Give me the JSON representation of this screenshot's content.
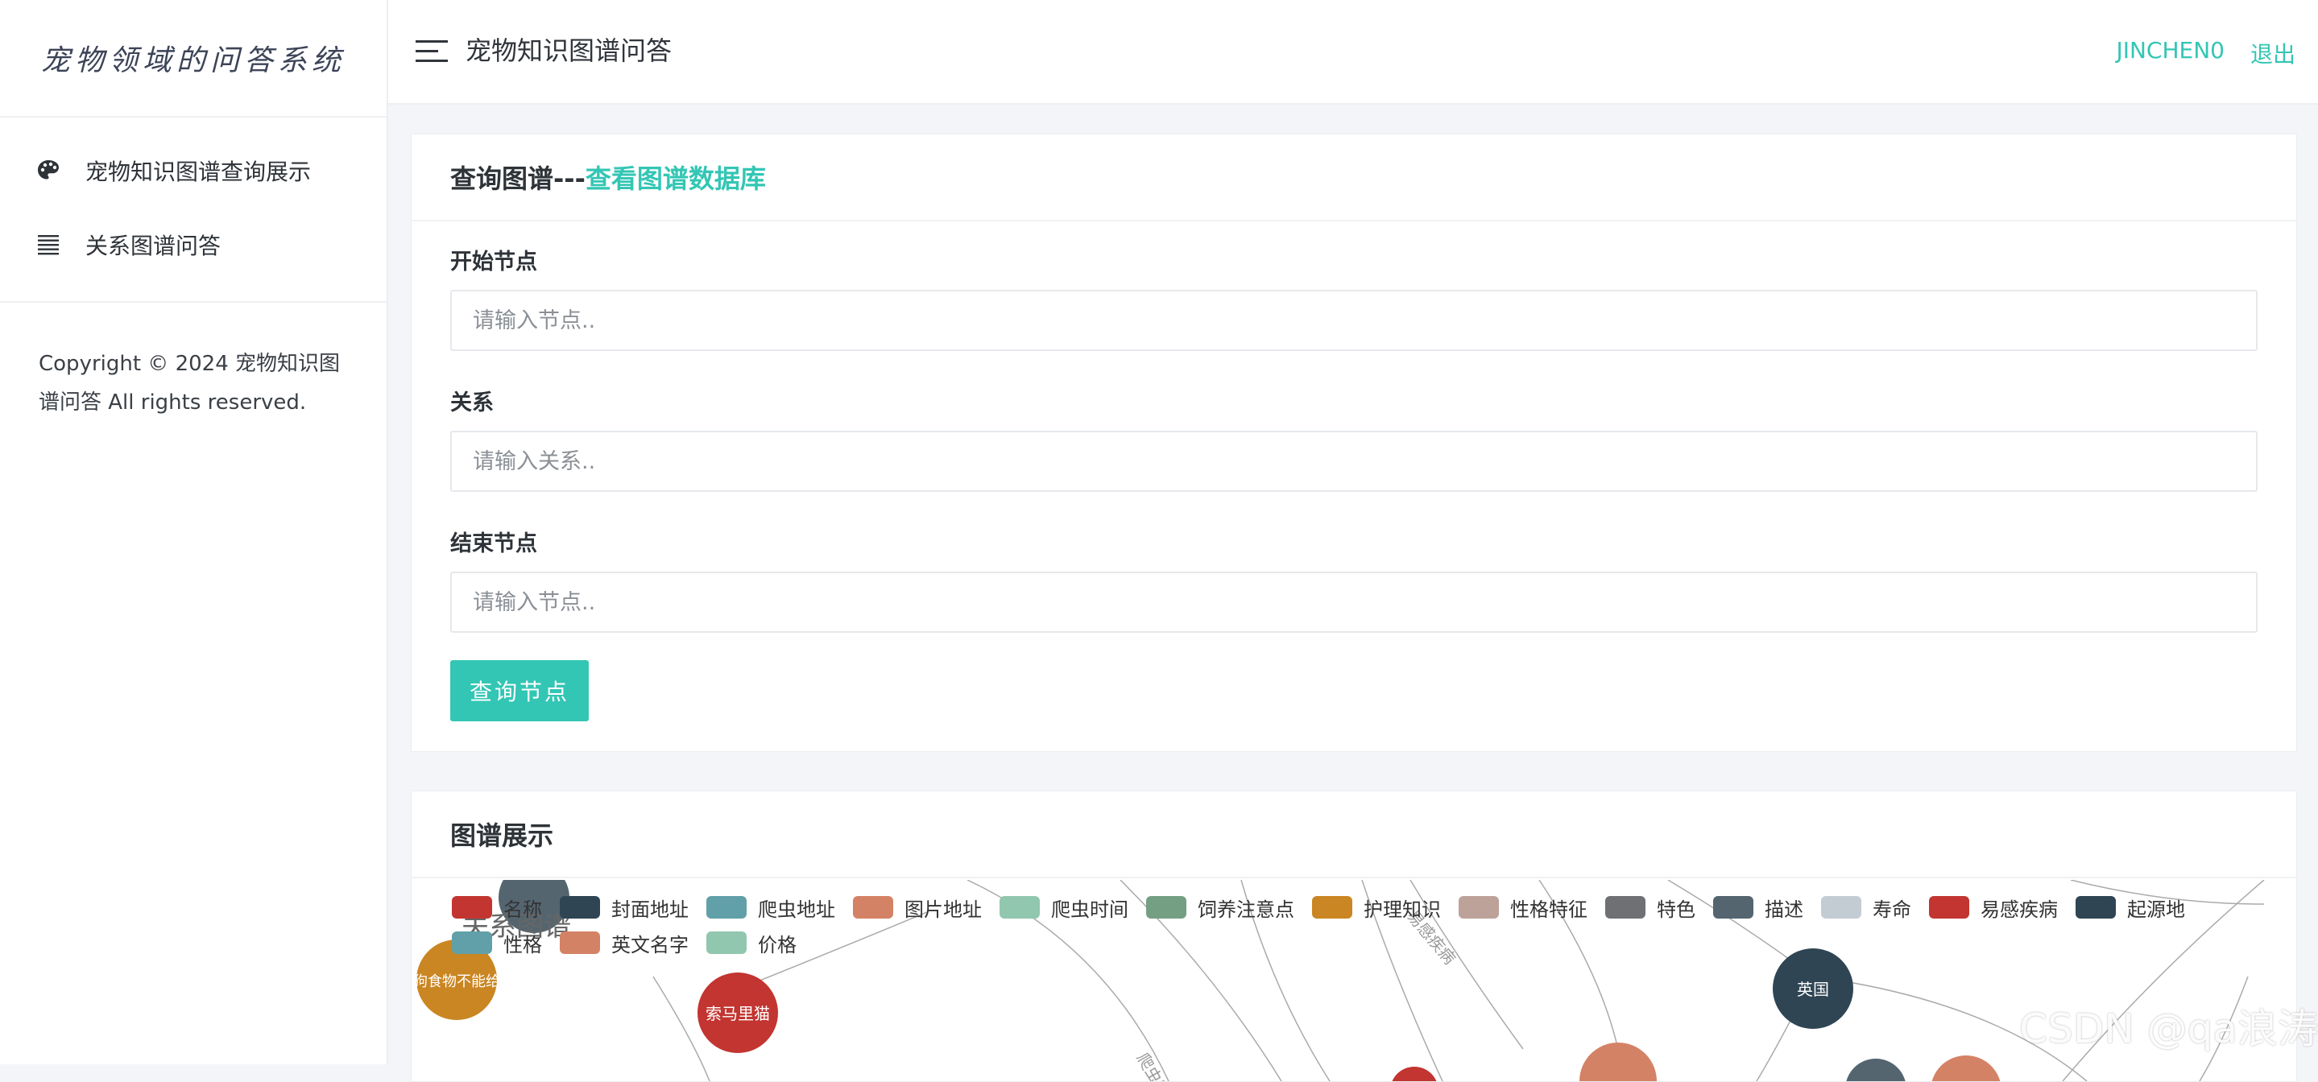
{
  "brand": {
    "title": "宠物领域的问答系统"
  },
  "sidebar": {
    "items": [
      {
        "label": "宠物知识图谱查询展示",
        "icon": "palette-icon"
      },
      {
        "label": "关系图谱问答",
        "icon": "list-icon"
      }
    ],
    "copyright": "Copyright © 2024 宠物知识图谱问答 All rights reserved."
  },
  "header": {
    "title": "宠物知识图谱问答",
    "user": "JINCHEN0",
    "logout": "退出",
    "menu_icon": "hamburger-menu-icon"
  },
  "query_card": {
    "title_prefix": "查询图谱---",
    "title_link": "查看图谱数据库",
    "fields": [
      {
        "label": "开始节点",
        "placeholder": "请输入节点.."
      },
      {
        "label": "关系",
        "placeholder": "请输入关系.."
      },
      {
        "label": "结束节点",
        "placeholder": "请输入节点.."
      }
    ],
    "button": "查询节点"
  },
  "graph_card": {
    "title": "图谱展示",
    "chart_title": "关系图谱",
    "legend": [
      {
        "name": "名称",
        "color": "#c23531"
      },
      {
        "name": "封面地址",
        "color": "#2f4554"
      },
      {
        "name": "爬虫地址",
        "color": "#61a0a8"
      },
      {
        "name": "图片地址",
        "color": "#d48265"
      },
      {
        "name": "爬虫时间",
        "color": "#91c7ae"
      },
      {
        "name": "饲养注意点",
        "color": "#749f83"
      },
      {
        "name": "护理知识",
        "color": "#ca8622"
      },
      {
        "name": "性格特征",
        "color": "#bda29a"
      },
      {
        "name": "特色",
        "color": "#6e7074"
      },
      {
        "name": "描述",
        "color": "#546570"
      },
      {
        "name": "寿命",
        "color": "#c4ccd3"
      },
      {
        "name": "易感疾病",
        "color": "#c23531"
      },
      {
        "name": "起源地",
        "color": "#2f4554"
      },
      {
        "name": "性格",
        "color": "#61a0a8"
      },
      {
        "name": "英文名字",
        "color": "#d48265"
      },
      {
        "name": "价格",
        "color": "#91c7ae"
      }
    ],
    "nodes": [
      {
        "label": "英国",
        "color": "#2f4554"
      },
      {
        "label": "索马里猫",
        "color": "#c23531"
      },
      {
        "label": "狗食物不能给",
        "color": "#ca8622"
      }
    ],
    "edge_labels": [
      "爬虫时间",
      "易感疾病"
    ]
  },
  "watermark": "CSDN @qa浪涛"
}
